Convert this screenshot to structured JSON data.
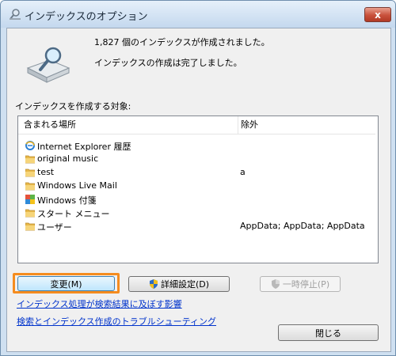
{
  "window": {
    "title": "インデックスのオプション",
    "close_glyph": "x"
  },
  "summary": {
    "count_text": "1,827 個のインデックスが作成されました。",
    "status_text": "インデックスの作成は完了しました。"
  },
  "index_label": "インデックスを作成する対象:",
  "list": {
    "columns": [
      "含まれる場所",
      "除外"
    ],
    "rows": [
      {
        "icon": "internet-explorer-icon",
        "location": "Internet Explorer 履歴",
        "exclude": ""
      },
      {
        "icon": "folder-icon",
        "location": "original music",
        "exclude": ""
      },
      {
        "icon": "folder-icon",
        "location": "test",
        "exclude": "a"
      },
      {
        "icon": "folder-icon",
        "location": "Windows Live Mail",
        "exclude": ""
      },
      {
        "icon": "windows-notes-icon",
        "location": "Windows 付箋",
        "exclude": ""
      },
      {
        "icon": "folder-icon",
        "location": "スタート メニュー",
        "exclude": ""
      },
      {
        "icon": "folder-icon",
        "location": "ユーザー",
        "exclude": "AppData; AppData; AppData"
      }
    ]
  },
  "buttons": {
    "change": "変更(M)",
    "advanced": "詳細設定(D)",
    "pause": "一時停止(P)",
    "close": "閉じる"
  },
  "links": {
    "affect_search": "インデックス処理が検索結果に及ぼす影響",
    "troubleshoot": "検索とインデックス作成のトラブルシューティング"
  },
  "colors": {
    "focus_highlight": "#f58c1f",
    "link": "#0033cc",
    "title_bar": "#cfe0f1"
  }
}
